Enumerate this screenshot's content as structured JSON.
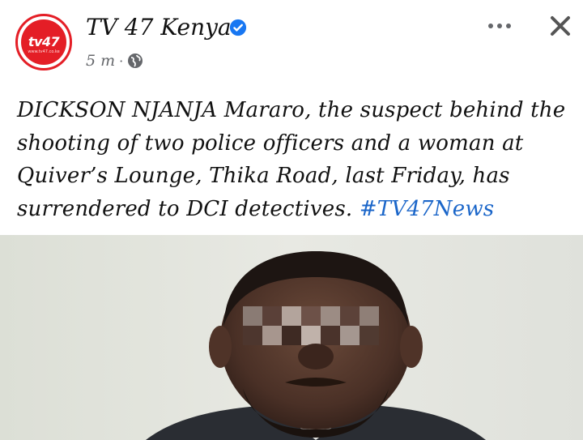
{
  "post": {
    "page_name": "TV 47 Kenya",
    "logo_text": "tv47",
    "logo_subtext": "www.tv47.co.ke",
    "time": "5 m",
    "separator": "·",
    "privacy_icon": "globe-icon",
    "verified_icon": "verified-badge-icon",
    "body_text": "DICKSON NJANJA Mararo, the suspect behind the shooting of two police officers and a woman at Quiver’s Lounge, Thika Road, last Friday, has surrendered to DCI detectives. ",
    "hashtag": "#TV47News",
    "image_alt": "Photo of the suspect with blurred eyes against a light wall"
  },
  "colors": {
    "brand_red": "#e41e26",
    "link_blue": "#1b66c9",
    "verified_blue": "#1877f2",
    "muted": "#65676b"
  }
}
